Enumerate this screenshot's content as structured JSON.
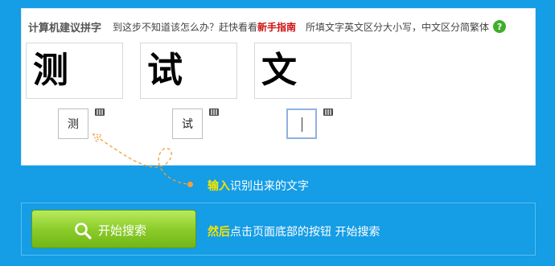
{
  "header": {
    "title": "计算机建议拼字",
    "hint": "到这步不知道该怎么办？赶快看看",
    "guide_link": "新手指南",
    "note": "所填文字英文区分大小写，中文区分简繁体",
    "help_symbol": "?"
  },
  "captcha": {
    "chars": [
      "测",
      "试",
      "文"
    ],
    "inputs": [
      {
        "value": "测"
      },
      {
        "value": "试"
      },
      {
        "value": ""
      }
    ]
  },
  "step1": {
    "highlight": "输入",
    "text": "识别出来的文字"
  },
  "search": {
    "button_label": "开始搜索"
  },
  "step2": {
    "highlight": "然后",
    "text": "点击页面底部的按钮 开始搜索"
  },
  "colors": {
    "background": "#159de6",
    "highlight": "#f5e400",
    "button_green": "#8ccd2b",
    "link_red": "#cc1111"
  },
  "icons": [
    "help-icon",
    "keyboard-icon",
    "search-icon",
    "dashed-arrow"
  ]
}
